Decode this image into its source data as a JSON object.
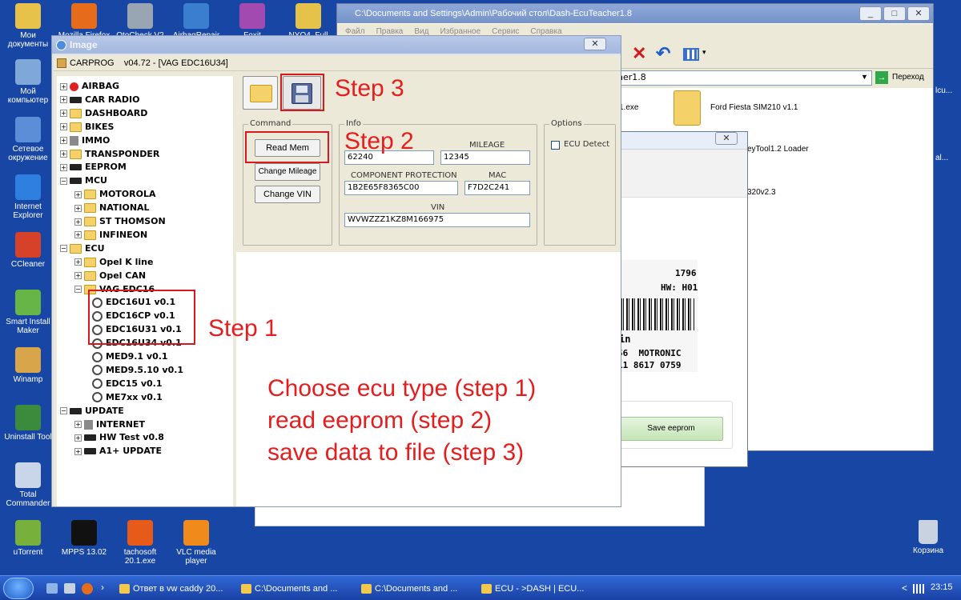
{
  "desktop_left": [
    {
      "label": "Мои документы",
      "color": "#e6c24a"
    },
    {
      "label": "Мой компьютер",
      "color": "#7fa7d8"
    },
    {
      "label": "Сетевое окружение",
      "color": "#5a8fd8"
    },
    {
      "label": "Internet Explorer",
      "color": "#2f7fe0"
    },
    {
      "label": "CCleaner",
      "color": "#d6412a"
    },
    {
      "label": "Smart Install Maker",
      "color": "#67b546"
    },
    {
      "label": "Winamp",
      "color": "#d9a54a"
    },
    {
      "label": "Uninstall Tool",
      "color": "#3c8b3c"
    },
    {
      "label": "Total Commander",
      "color": "#c9d6ea"
    },
    {
      "label": "uTorrent",
      "color": "#77b03a"
    }
  ],
  "desktop_top": [
    {
      "label": "Mozilla Firefox",
      "color": "#e66b1a"
    },
    {
      "label": "OtoCheck V2",
      "color": "#9aa5b3"
    },
    {
      "label": "AirbagRepair",
      "color": "#3a7ed0"
    },
    {
      "label": "Foxit",
      "color": "#a24ab0"
    },
    {
      "label": "NYO4_Full",
      "color": "#e6c24a"
    }
  ],
  "desktop_bottom": [
    {
      "label": "MPPS 13.02",
      "color": "#111111"
    },
    {
      "label": "tachosoft 20.1.exe",
      "color": "#e65a1a"
    },
    {
      "label": "VLC media player",
      "color": "#f08a1a"
    }
  ],
  "recycle_bin": "Корзина",
  "explorer": {
    "title": "C:\\Documents and Settings\\Admin\\Рабочий стол\\Dash-EcuTeacher1.8",
    "menu": [
      "Файл",
      "Правка",
      "Вид",
      "Избранное",
      "Сервис",
      "Справка"
    ],
    "address": "her1.8",
    "go_label": "Переход",
    "files": [
      "1.exe",
      "Ford Fiesta SIM210 v1.1",
      "eyTool1.2 Loader",
      "320v2.3"
    ],
    "right_clip_1": "lcu...",
    "right_clip_2": "al..."
  },
  "ecu_window": {
    "save_button": "Save eeprom",
    "label_lines": [
      "1796",
      "HW: H01",
      "in",
      "56  MOTRONIC",
      "11 8617 0759"
    ]
  },
  "image_window": {
    "title": "Image",
    "close_icon": "✕"
  },
  "carprog": {
    "title": "CARPROG    v04.72 - [VAG EDC16U34]",
    "tree": [
      {
        "label": "AIRBAG",
        "level": 0,
        "icon": "red"
      },
      {
        "label": "CAR RADIO",
        "level": 0,
        "icon": "chip"
      },
      {
        "label": "DASHBOARD",
        "level": 0,
        "icon": "folder"
      },
      {
        "label": "BIKES",
        "level": 0,
        "icon": "folder"
      },
      {
        "label": "IMMO",
        "level": 0,
        "icon": "gray"
      },
      {
        "label": "TRANSPONDER",
        "level": 0,
        "icon": "folder"
      },
      {
        "label": "EEPROM",
        "level": 0,
        "icon": "chip"
      },
      {
        "label": "MCU",
        "level": 0,
        "icon": "chip"
      },
      {
        "label": "MOTOROLA",
        "level": 1,
        "icon": "folder"
      },
      {
        "label": "NATIONAL",
        "level": 1,
        "icon": "folder"
      },
      {
        "label": "ST THOMSON",
        "level": 1,
        "icon": "folder"
      },
      {
        "label": "INFINEON",
        "level": 1,
        "icon": "folder"
      },
      {
        "label": "ECU",
        "level": 0,
        "icon": "folder"
      },
      {
        "label": "Opel K line",
        "level": 1,
        "icon": "folder"
      },
      {
        "label": "Opel CAN",
        "level": 1,
        "icon": "folder"
      },
      {
        "label": "VAG EDC16",
        "level": 1,
        "icon": "folder"
      },
      {
        "label": "EDC16U1 v0.1",
        "level": 2,
        "icon": "vw"
      },
      {
        "label": "EDC16CP v0.1",
        "level": 2,
        "icon": "vw"
      },
      {
        "label": "EDC16U31 v0.1",
        "level": 2,
        "icon": "vw"
      },
      {
        "label": "EDC16U34 v0.1",
        "level": 2,
        "icon": "vw"
      },
      {
        "label": "MED9.1 v0.1",
        "level": 2,
        "icon": "vw"
      },
      {
        "label": "MED9.5.10 v0.1",
        "level": 2,
        "icon": "vw"
      },
      {
        "label": "EDC15 v0.1",
        "level": 2,
        "icon": "vw"
      },
      {
        "label": "ME7xx v0.1",
        "level": 2,
        "icon": "vw"
      },
      {
        "label": "UPDATE",
        "level": 0,
        "icon": "chip"
      },
      {
        "label": "INTERNET",
        "level": 1,
        "icon": "gray"
      },
      {
        "label": "HW Test v0.8",
        "level": 1,
        "icon": "chip"
      },
      {
        "label": "A1+ UPDATE",
        "level": 1,
        "icon": "chip"
      }
    ],
    "command": {
      "label": "Command",
      "read_mem": "Read Mem",
      "change_mileage": "Change Mileage",
      "change_vin": "Change VIN"
    },
    "info": {
      "label": "Info",
      "pin_value": "62240",
      "mileage_label": "MILEAGE",
      "mileage_value": "12345",
      "component_protection_label": "COMPONENT PROTECTION",
      "component_protection_value": "1B2E65F8365C00",
      "mac_label": "MAC",
      "mac_value": "F7D2C241",
      "vin_label": "VIN",
      "vin_value": "WVWZZZ1KZ8M166975"
    },
    "options": {
      "label": "Options",
      "ecu_detect": "ECU Detect"
    }
  },
  "annotations": {
    "step1": "Step 1",
    "step2": "Step 2",
    "step3": "Step 3",
    "instr_line1": "Choose ecu type (step 1)",
    "instr_line2": "read eeprom (step 2)",
    "instr_line3": "save data to file (step 3)"
  },
  "taskbar": {
    "tasks": [
      "Ответ в vw caddy 20...",
      "C:\\Documents and ...",
      "C:\\Documents and ...",
      "ECU - >DASH | ECU..."
    ],
    "clock": "23:15",
    "lang_arrow": "<"
  },
  "colors": {
    "desktop": "#1846a5",
    "annotation": "#e41e1e",
    "titlebar": "#2c62d8"
  }
}
